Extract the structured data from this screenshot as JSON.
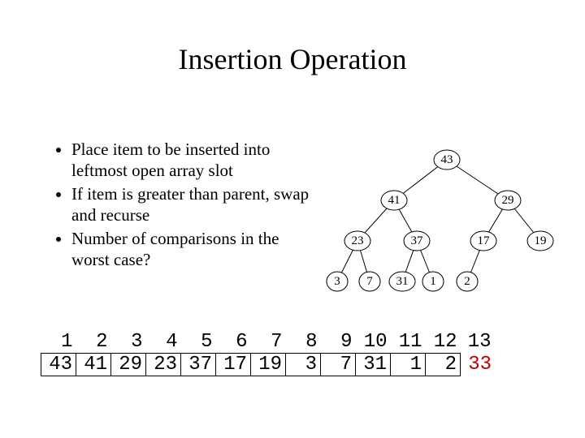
{
  "title": "Insertion Operation",
  "bullets": [
    "Place item to be inserted into leftmost open array slot",
    "If item is greater than parent, swap and recurse",
    "Number of comparisons in the worst case?"
  ],
  "tree": {
    "n1": "43",
    "n2": "41",
    "n3": "29",
    "n4": "23",
    "n5": "37",
    "n6": "17",
    "n7": "19",
    "n8": "3",
    "n9": "7",
    "n10": "31",
    "n11": "1",
    "n12": "2"
  },
  "array": {
    "indices": [
      "1",
      "2",
      "3",
      "4",
      "5",
      "6",
      "7",
      "8",
      "9",
      "10",
      "11",
      "12",
      "13"
    ],
    "values": [
      "43",
      "41",
      "29",
      "23",
      "37",
      "17",
      "19",
      "3",
      "7",
      "31",
      "1",
      "2",
      "33"
    ]
  }
}
